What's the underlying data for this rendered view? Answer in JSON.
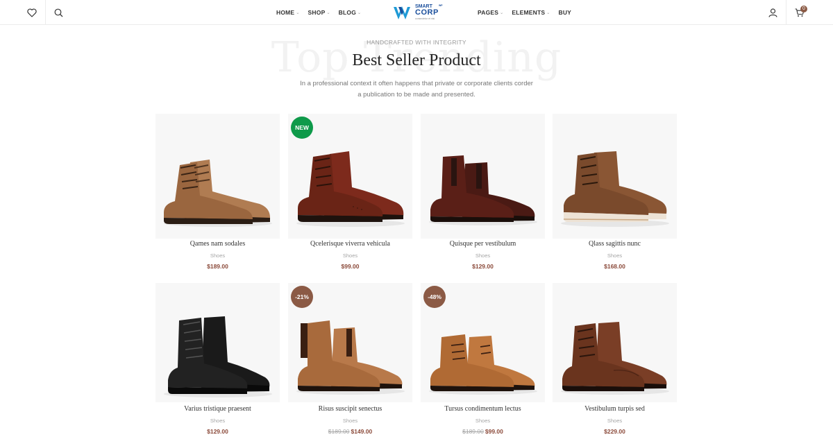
{
  "header": {
    "nav_left": [
      {
        "label": "HOME",
        "has_caret": true
      },
      {
        "label": "SHOP",
        "has_caret": true
      },
      {
        "label": "BLOG",
        "has_caret": true
      }
    ],
    "nav_right": [
      {
        "label": "PAGES",
        "has_caret": true
      },
      {
        "label": "ELEMENTS",
        "has_caret": true
      },
      {
        "label": "BUY",
        "has_caret": false
      }
    ],
    "logo": {
      "line1": "SMART",
      "line2": "CORP",
      "tm": "WP",
      "tagline": "consectetur et nisi"
    },
    "cart_count": "0",
    "icons": {
      "left": [
        "heart-icon",
        "search-icon"
      ],
      "right": [
        "user-icon",
        "cart-icon"
      ]
    }
  },
  "section": {
    "background_word": "Top Trending",
    "eyebrow": "HANDCRAFTED WITH INTEGRITY",
    "title": "Best Seller Product",
    "description": "In a professional context it often happens that private or corporate clients corder a publication to be made and presented."
  },
  "colors": {
    "new_badge": "#0e9a4a",
    "sale_badge": "#8b5a45",
    "price": "#8b4a3a"
  },
  "products": [
    {
      "name": "Qames nam sodales",
      "category": "Shoes",
      "price": "$189.00",
      "old_price": "",
      "badge": ""
    },
    {
      "name": "Qcelerisque viverra vehicula",
      "category": "Shoes",
      "price": "$99.00",
      "old_price": "",
      "badge": "NEW"
    },
    {
      "name": "Quisque per vestibulum",
      "category": "Shoes",
      "price": "$129.00",
      "old_price": "",
      "badge": ""
    },
    {
      "name": "Qlass sagittis nunc",
      "category": "Shoes",
      "price": "$168.00",
      "old_price": "",
      "badge": ""
    },
    {
      "name": "Varius tristique praesent",
      "category": "Shoes",
      "price": "$129.00",
      "old_price": "",
      "badge": ""
    },
    {
      "name": "Risus suscipit senectus",
      "category": "Shoes",
      "price": "$149.00",
      "old_price": "$189.00",
      "badge": "-21%"
    },
    {
      "name": "Tursus condimentum lectus",
      "category": "Shoes",
      "price": "$99.00",
      "old_price": "$189.00",
      "badge": "-48%"
    },
    {
      "name": "Vestibulum turpis sed",
      "category": "Shoes",
      "price": "$229.00",
      "old_price": "",
      "badge": ""
    }
  ]
}
